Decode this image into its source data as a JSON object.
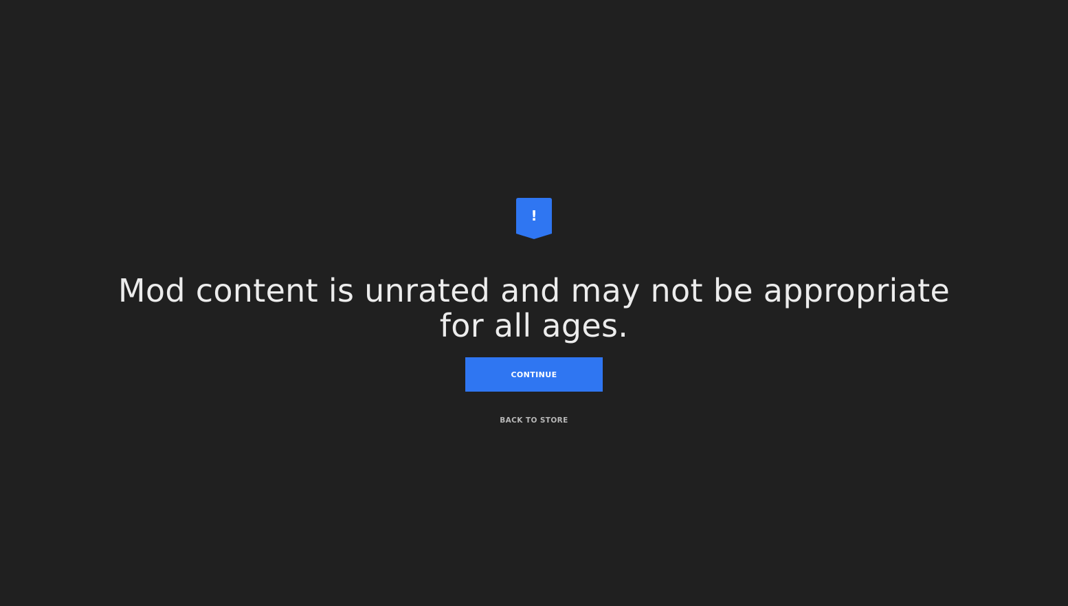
{
  "notice": {
    "icon": "warning-shield-icon",
    "icon_mark": "!",
    "accent_color": "#2f76f2",
    "background_color": "#202020",
    "message": "Mod content is unrated and may not be appropriate for all ages."
  },
  "actions": {
    "continue_label": "CONTINUE",
    "back_label": "BACK TO STORE"
  }
}
